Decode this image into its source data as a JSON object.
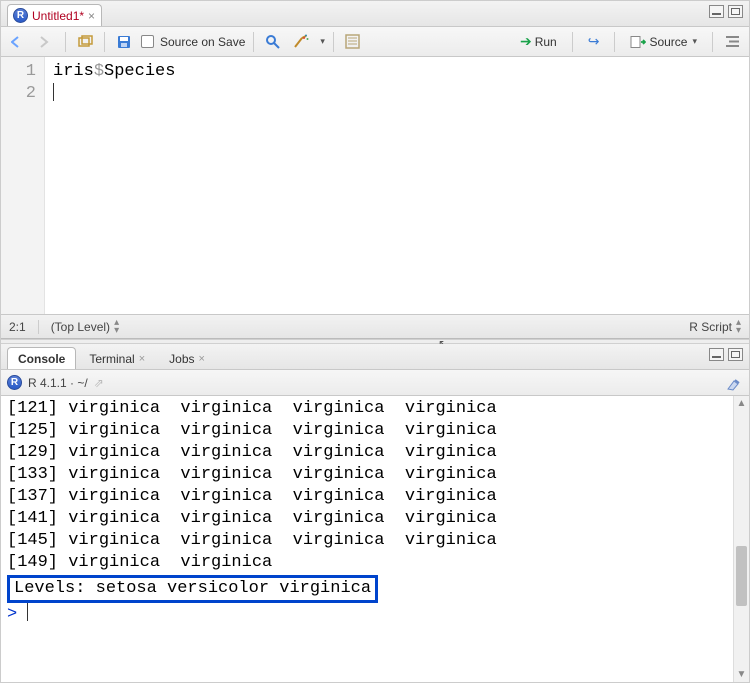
{
  "source": {
    "tab_title": "Untitled1*",
    "toolbar": {
      "source_on_save_label": "Source on Save",
      "run_label": "Run",
      "source_label": "Source"
    },
    "lines": {
      "n1": "1",
      "n2": "2",
      "code1_pre": "iris",
      "code1_dollar": "$",
      "code1_post": "Species"
    },
    "status": {
      "pos": "2:1",
      "scope": "(Top Level)",
      "type": "R Script"
    }
  },
  "console": {
    "tabs": {
      "console": "Console",
      "terminal": "Terminal",
      "jobs": "Jobs"
    },
    "header": "R 4.1.1 · ~/",
    "rows": [
      "[121] virginica  virginica  virginica  virginica",
      "[125] virginica  virginica  virginica  virginica",
      "[129] virginica  virginica  virginica  virginica",
      "[133] virginica  virginica  virginica  virginica",
      "[137] virginica  virginica  virginica  virginica",
      "[141] virginica  virginica  virginica  virginica",
      "[145] virginica  virginica  virginica  virginica",
      "[149] virginica  virginica"
    ],
    "levels_line": "Levels: setosa versicolor virginica",
    "prompt": ">"
  }
}
